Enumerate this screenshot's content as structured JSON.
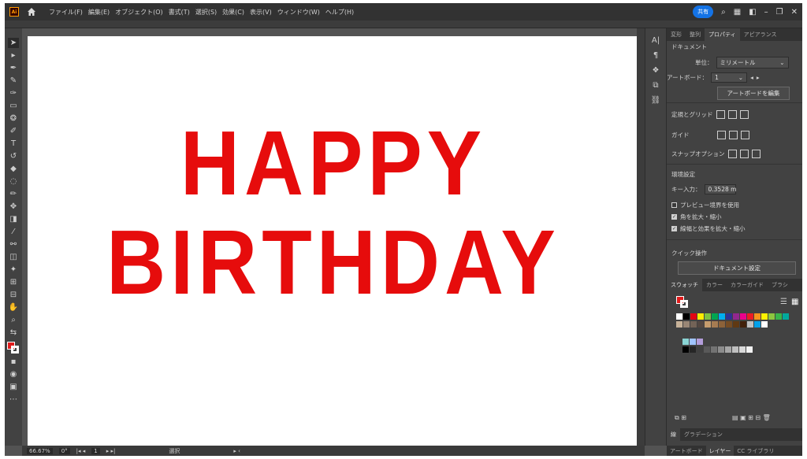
{
  "app": {
    "logo": "Ai"
  },
  "menu": [
    "ファイル(F)",
    "編集(E)",
    "オブジェクト(O)",
    "書式(T)",
    "選択(S)",
    "効果(C)",
    "表示(V)",
    "ウィンドウ(W)",
    "ヘルプ(H)"
  ],
  "menubar_right": {
    "share": "共有"
  },
  "canvas": {
    "line1": "HAPPY",
    "line2": "BIRTHDAY",
    "text_color": "#e60c0c"
  },
  "panel_tabs": [
    "変形",
    "整列",
    "プロパティ",
    "アピアランス"
  ],
  "properties": {
    "section_document": "ドキュメント",
    "unit_label": "単位：",
    "unit_value": "ミリメートル",
    "artboard_label": "アートボード：",
    "artboard_value": "1",
    "edit_artboard_button": "アートボードを編集",
    "rulers_grid_label": "定規とグリッド",
    "guides_label": "ガイド",
    "snap_label": "スナップオプション",
    "prefs_label": "環境設定",
    "key_input_label": "キー入力：",
    "key_input_value": "0.3528 m",
    "preview_boundary": "プレビュー境界を使用",
    "scale_corners": "角を拡大・縮小",
    "scale_strokes": "線幅と効果を拡大・縮小",
    "quick_actions_label": "クイック操作",
    "doc_settings_button": "ドキュメント設定"
  },
  "swatches_tabs": [
    "スウォッチ",
    "カラー",
    "カラーガイド",
    "ブラシ"
  ],
  "swatch_colors": {
    "row1": [
      "#ffffff",
      "#000000",
      "#e30613",
      "#ffed00",
      "#7cc242",
      "#00a651",
      "#00aeef",
      "#2e3192",
      "#92278f",
      "#ec008c",
      "#ed1c24",
      "#f7941d",
      "#fff200",
      "#8dc63f",
      "#39b54a",
      "#00a99d"
    ],
    "row2": [
      "#c7b299",
      "#998675",
      "#736357",
      "#534741",
      "#c69c6d",
      "#a67c52",
      "#8c6239",
      "#754c24",
      "#603913",
      "#42210b",
      "#bfbfbf",
      "#00a0e9",
      "#ffffff"
    ],
    "row3": [
      "#8ad4d4",
      "#a0c4ff",
      "#b39ddb"
    ],
    "row4": [
      "#000000",
      "#262626",
      "#404040",
      "#595959",
      "#737373",
      "#8c8c8c",
      "#a6a6a6",
      "#bfbfbf",
      "#d9d9d9",
      "#f2f2f2"
    ]
  },
  "bottom_tabs": [
    "線",
    "グラデーション"
  ],
  "bottom_tabs2": [
    "アートボード",
    "レイヤー",
    "CC ライブラリ"
  ],
  "status": {
    "zoom": "66.67%",
    "rotate": "0°",
    "artboard": "1",
    "tool": "選択"
  }
}
